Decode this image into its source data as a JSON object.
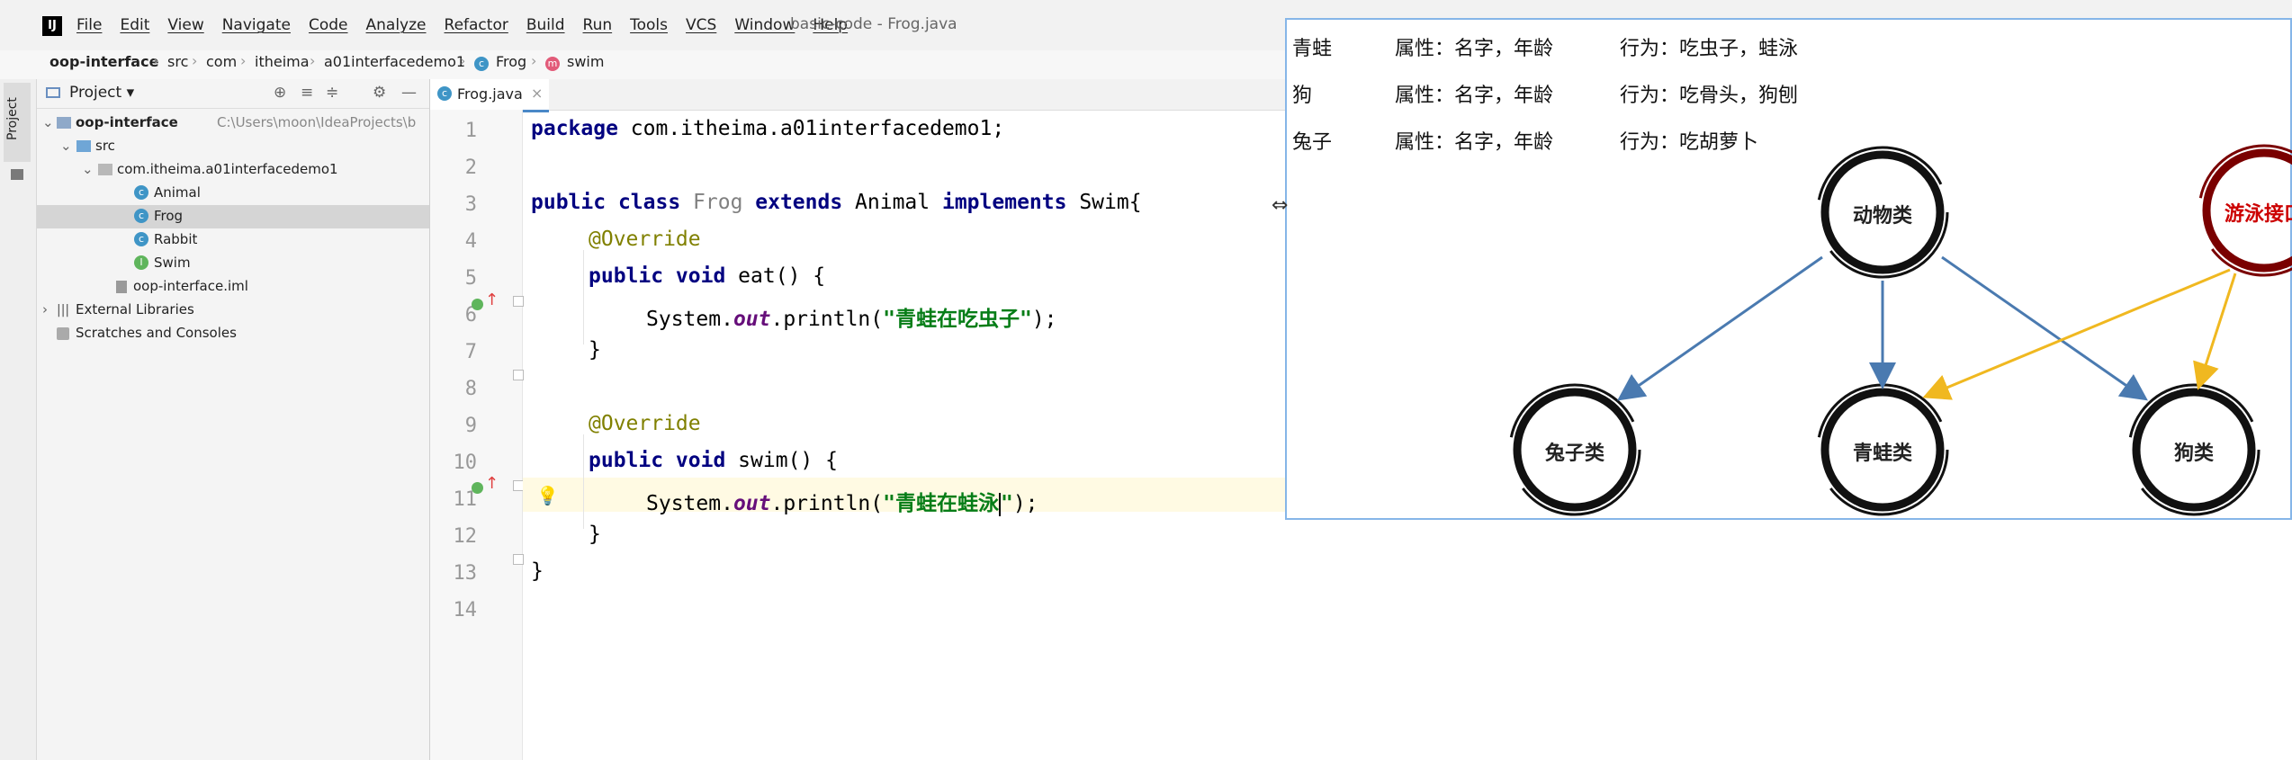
{
  "menubar": {
    "items": [
      "File",
      "Edit",
      "View",
      "Navigate",
      "Code",
      "Analyze",
      "Refactor",
      "Build",
      "Run",
      "Tools",
      "VCS",
      "Window",
      "Help"
    ],
    "window_title": "basic-code - Frog.java"
  },
  "breadcrumb": [
    "oop-interface",
    "src",
    "com",
    "itheima",
    "a01interfacedemo1",
    "Frog",
    "swim"
  ],
  "sidebar_strip": {
    "label": "Project"
  },
  "project_panel": {
    "title": "Project",
    "tree": [
      {
        "label": "oop-interface",
        "path": "C:\\Users\\moon\\IdeaProjects\\b",
        "indent": 0
      },
      {
        "label": "src",
        "indent": 1
      },
      {
        "label": "com.itheima.a01interfacedemo1",
        "indent": 2
      },
      {
        "label": "Animal",
        "indent": 3,
        "kind": "class"
      },
      {
        "label": "Frog",
        "indent": 3,
        "kind": "class",
        "selected": true
      },
      {
        "label": "Rabbit",
        "indent": 3,
        "kind": "class"
      },
      {
        "label": "Swim",
        "indent": 3,
        "kind": "interface"
      },
      {
        "label": "oop-interface.iml",
        "indent": 2
      },
      {
        "label": "External Libraries",
        "indent": 0
      },
      {
        "label": "Scratches and Consoles",
        "indent": 0
      }
    ]
  },
  "editor": {
    "tab_label": "Frog.java",
    "line_numbers": [
      "1",
      "2",
      "3",
      "4",
      "5",
      "6",
      "7",
      "8",
      "9",
      "10",
      "11",
      "12",
      "13",
      "14"
    ],
    "code": {
      "l1_kw": "package",
      "l1_rest": " com.itheima.a01interfacedemo1;",
      "l3_public": "public",
      "l3_class": " class ",
      "l3_name": "Frog",
      "l3_extends": " extends ",
      "l3_parent": "Animal",
      "l3_impl": " implements ",
      "l3_iface": "Swim{",
      "l4": "@Override",
      "l5_kw": "public void",
      "l5_rest": " eat() {",
      "l6_a": "System.",
      "l6_out": "out",
      "l6_b": ".println(",
      "l6_str": "\"青蛙在吃虫子\"",
      "l6_c": ");",
      "l7": "}",
      "l9": "@Override",
      "l10_kw": "public void",
      "l10_rest": " swim() {",
      "l11_a": "System.",
      "l11_out": "out",
      "l11_b": ".println(",
      "l11_str": "\"青蛙在蛙泳",
      "l11_str_end": "\"",
      "l11_c": ");",
      "l12": "}",
      "l13": "}"
    }
  },
  "diagram": {
    "rows": [
      {
        "name": "青蛙",
        "attrs": "属性：名字，年龄",
        "behaviors": "行为：吃虫子，蛙泳"
      },
      {
        "name": "狗",
        "attrs": "属性：名字，年龄",
        "behaviors": "行为：吃骨头，狗刨"
      },
      {
        "name": "兔子",
        "attrs": "属性：名字，年龄",
        "behaviors": "行为：吃胡萝卜"
      }
    ],
    "nodes": {
      "animal": "动物类",
      "swim_interface": "游泳接口",
      "rabbit": "兔子类",
      "frog": "青蛙类",
      "dog": "狗类"
    },
    "colors": {
      "inherit_arrow": "#4a7ab0",
      "implement_arrow": "#f0b820",
      "interface_ring": "#7a0000",
      "interface_text": "#cc0000"
    }
  }
}
